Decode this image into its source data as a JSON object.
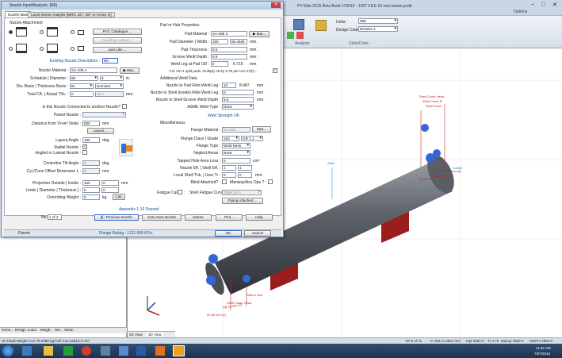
{
  "app": {
    "title": "PV Elite 2015 Beta Build 170910 - 1057 FILE 10 new boxes.pvdb",
    "window_controls": [
      "–",
      "□",
      "✕"
    ],
    "qat_right": "Options"
  },
  "ribbon": {
    "units_label": "Units:",
    "units_value": "MM",
    "design_code_label": "Design Code:",
    "design_code_value": "Division 1",
    "group_units_code": "Units/Code",
    "group_analysis": "Analysis"
  },
  "dialog": {
    "title": "Nozzle Input/Analysis: [N0]",
    "tabs": [
      "Nozzle Main",
      "Local Stress Analysis [WRC 107, 297 or Annex G]"
    ],
    "nozzle_attachment": {
      "header": "Nozzle Attachment",
      "btn_pvc": "PVC Catalogue ...",
      "btn_coupling": "Coupling Lookup ...",
      "btn_justlike": "Just Like ..."
    },
    "left": {
      "existing_desc_label": "Existing Nozzle Description :",
      "existing_desc_value": "N0",
      "material_label": "Nozzle Material :",
      "material_value": "SA-106 A",
      "mat_btn": "Mat...",
      "schedule_label": "Schedule | Diameter :",
      "schedule_value": "80",
      "diameter_value": "8",
      "diameter_unit": "in.",
      "dia_basis_label": "Dia. Basis | Thickness Basis :",
      "dia_basis_value": "ID",
      "thk_basis_value": "Nominal",
      "total_ca_label": "Total CA. | Actual Thk. :",
      "total_ca_value": "0",
      "actual_thk_value": "12.7",
      "actual_thk_unit": "mm.",
      "connected_label": "Is this Nozzle Connected to another Nozzle?",
      "parent_label": "Parent Nozzle :",
      "dist_label": "Distance from 'From' Node :",
      "dist_value": "500",
      "dist_unit": "mm.",
      "layout_btn": "Layout ...",
      "layout_angle_label": "Layout Angle :",
      "layout_angle_value": "180",
      "layout_angle_unit": "deg.",
      "radial_label": "Radial Nozzle :",
      "angled_label": "Angled or Lateral Nozzle :",
      "tilt_label": "Centerline Tilt Angle :",
      "tilt_value": "0",
      "tilt_unit": "deg.",
      "offset_label": "Cyl./Cone Offset Dimension L :",
      "offset_value": "0",
      "offset_unit": "mm.",
      "proj_label": "Projection Outside | Inside :",
      "proj_out_value": "150",
      "proj_in_value": "0",
      "proj_unit": "mm.",
      "limits_label": "Limits [ Diameter | Thickness ] :",
      "limit_d_value": "0",
      "limit_t_value": "0",
      "override_label": "Overriding Weight :",
      "override_value": "0",
      "override_unit": "kg.",
      "calc_btn": "Calc"
    },
    "right": {
      "pad_header": "Pad or Hub Properties",
      "pad_material_label": "Pad Material :",
      "pad_material_value": "SA-285 C",
      "pad_mat_btn": "Mat...",
      "pad_dia_label": "Pad Diameter | Width :",
      "pad_dia_value": "330",
      "pad_width_value": "55.4625",
      "pad_unit": "mm.",
      "pad_thk_label": "Pad Thickness :",
      "pad_thk_value": "9.5",
      "pad_thk_unit": "mm.",
      "groove_label": "Groove Weld Depth :",
      "groove_value": "9.5",
      "groove_unit": "mm.",
      "weld_leg_od_label": "Weld Leg at Pad OD :",
      "weld_leg_od_value": "8",
      "weld_leg_od_value2": "6.719",
      "weld_leg_od_unit": "mm.",
      "ug37_label": "For VIII-1 split pads, multiply A5 by 0.75 per UG-37(h) :",
      "add_weld_header": "Additional Weld Data",
      "pad_fillet_label": "Nozzle to Pad Fillet Weld Leg :",
      "pad_fillet_value": "10",
      "pad_fillet_value2": "8.487",
      "pad_fillet_unit": "mm.",
      "shell_inside_label": "Nozzle to Shell (inside) Fillet Weld Leg :",
      "shell_inside_value": "0",
      "shell_inside_unit": "mm.",
      "shell_groove_label": "Nozzle to Shell Groove Weld Depth :",
      "shell_groove_value": "9.5",
      "shell_groove_unit": "mm.",
      "asme_weld_label": "ASME Weld Type :",
      "asme_weld_value": "None",
      "weld_strength_link": "Weld Strength OK",
      "misc_header": "Miscellaneous",
      "flange_mat_label": "Flange Material :",
      "flange_mat_value": "SA-181",
      "flange_mat_btn": "Mat...",
      "flange_class_label": "Flange Class | Grade :",
      "flange_class_value": "150",
      "flange_grade_value": "GR 1.1",
      "flange_type_label": "Flange Type :",
      "flange_type_value": "Weld Neck",
      "neglect_label": "Neglect Areas :",
      "neglect_value": "None",
      "tapped_label": "Tapped Hole Area Loss :",
      "tapped_value": "0",
      "tapped_unit": "cm²",
      "eff_label": "Nozzle Eff. | Shell Eff. :",
      "eff_nozzle": "1",
      "eff_shell": "1",
      "local_thk_label": "Local Shell Thk. | User Tr :",
      "local_thk_value": "0",
      "user_tr_value": "0",
      "local_thk_unit": "mm.",
      "blind_label": "Blind Attached? :",
      "manway_label": "Manway/Acs Ope ? :",
      "fatigue_label": "Fatigue Calc ? :",
      "shell_fatigue_label": "Shell Fatigue Curve :",
      "shell_fatigue_value": "Table 3.F.1",
      "piping_btn": "Piping Attached ..."
    },
    "appendix_text": "Appendix 1-10 Passed",
    "nav_label": "No:",
    "nav_value": "1 of 2",
    "buttons": [
      "Previous Nozzle",
      "Goto Next Nozzle",
      "Delete",
      "Plot...",
      "Help"
    ],
    "status_left": "Parent",
    "status_mid": "Flange Rating : 1211.999 KPa.",
    "ok": "OK",
    "cancel": "Cancel"
  },
  "viewport": {
    "labels": [
      "Shell Cover Head",
      "Shell Cover R",
      "Shell Cover",
      "Shell",
      "Saddle",
      "Datum Line",
      "Shell Cover Head",
      "PB 10 mm (2)",
      "20.85 mm (4)",
      "DS.50 mm (8)",
      "S5.85 mm (1)",
      "S0.90 mm"
    ],
    "tabs": [
      "2D View",
      "3D View"
    ]
  },
  "left_panel_tabs": [
    "Gene...",
    "Design",
    "Load...",
    "Weigh...",
    "Sei...",
    "Wind..."
  ],
  "statusbar": {
    "left": "ID Head Weight Con 79.6389 Kgf  Vol Con 53412.0 cm³",
    "items": [
      "E# 6 of 11",
      "Fr 621 to 4621 mm",
      "Inpt 2652.0",
      "Tr 4.75",
      "Maxup 2652.0",
      "MinPrs 2652.0"
    ]
  },
  "taskbar": {
    "time": "11:02 AM",
    "date": "7/07/2015"
  }
}
